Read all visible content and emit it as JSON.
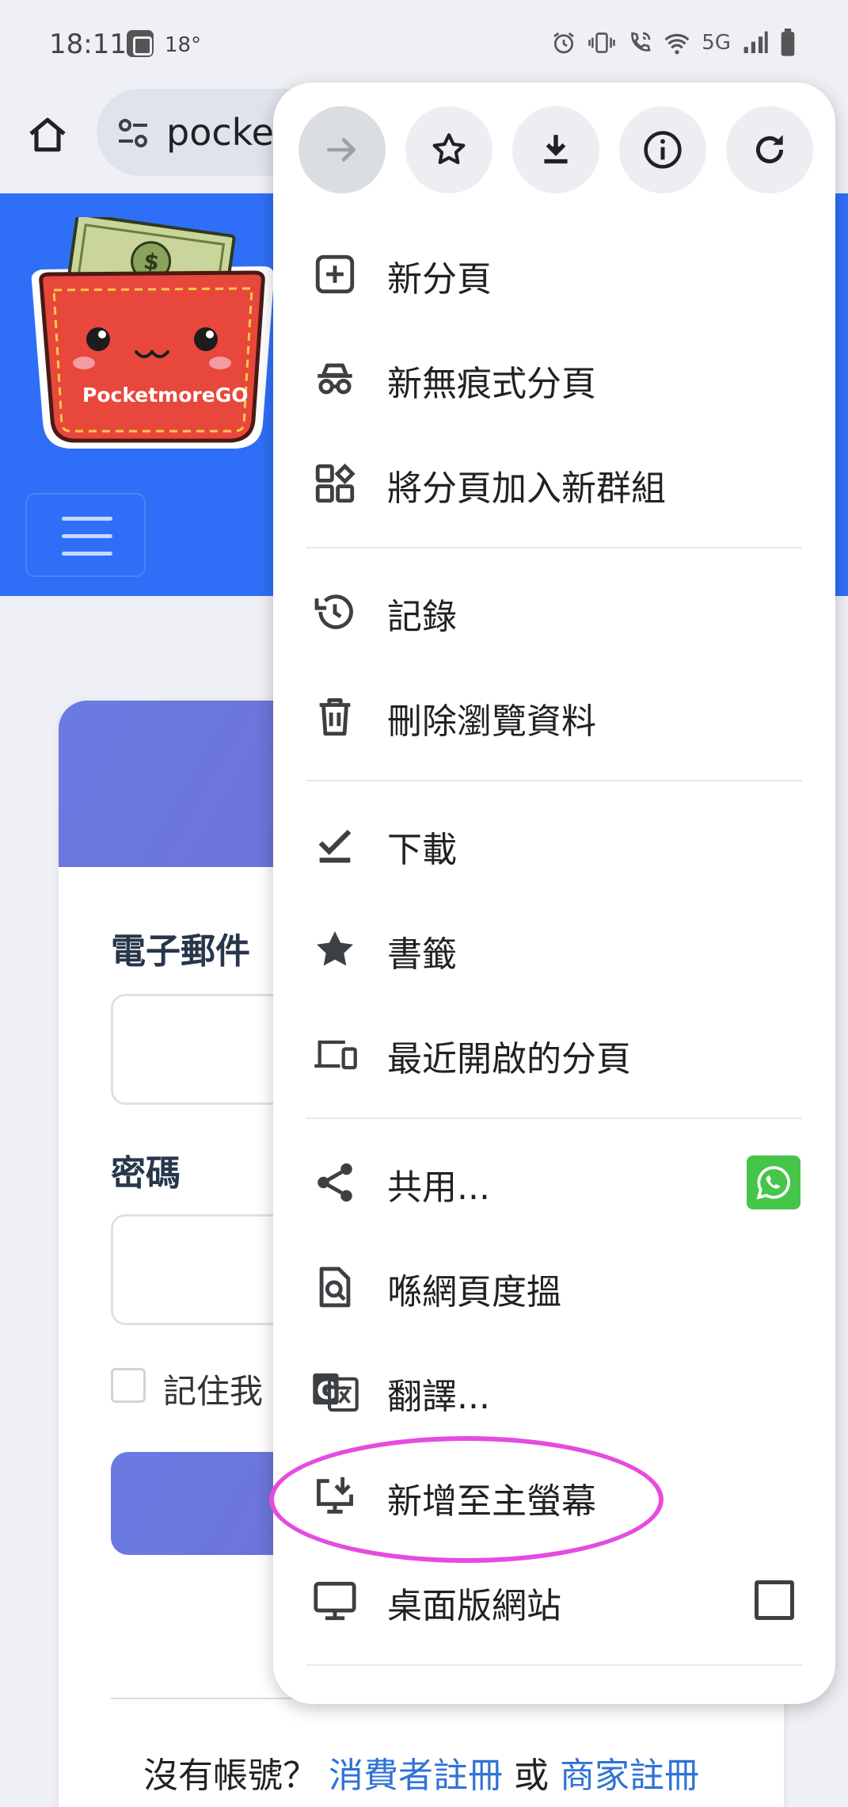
{
  "status_bar": {
    "time": "18:11",
    "temperature": "18°",
    "network": "5G",
    "icons": [
      "weather-icon",
      "alarm-icon",
      "vibrate-icon",
      "wifi-call-icon",
      "wifi-icon",
      "signal-icon",
      "battery-icon"
    ]
  },
  "toolbar": {
    "url_text": "pocket"
  },
  "page": {
    "logo_text": "PocketmoreGO",
    "email_label": "電子郵件",
    "password_label": "密碼",
    "remember_label": "記住我",
    "register_prefix": "沒有帳號？",
    "consumer_register": "消費者註冊",
    "or_text": "或",
    "merchant_register": "商家註冊"
  },
  "menu": {
    "top_actions": [
      "forward-icon",
      "bookmark-star-icon",
      "download-icon",
      "info-icon",
      "refresh-icon"
    ],
    "items": [
      {
        "label": "新分頁",
        "icon": "new-tab-icon"
      },
      {
        "label": "新無痕式分頁",
        "icon": "incognito-icon"
      },
      {
        "label": "將分頁加入新群組",
        "icon": "tab-group-icon"
      },
      {
        "label": "記錄",
        "icon": "history-icon"
      },
      {
        "label": "刪除瀏覽資料",
        "icon": "trash-icon"
      },
      {
        "label": "下載",
        "icon": "downloads-icon"
      },
      {
        "label": "書籤",
        "icon": "bookmarks-icon"
      },
      {
        "label": "最近開啟的分頁",
        "icon": "recent-tabs-icon"
      },
      {
        "label": "共用...",
        "icon": "share-icon"
      },
      {
        "label": "喺網頁度搵",
        "icon": "find-in-page-icon"
      },
      {
        "label": "翻譯...",
        "icon": "translate-icon"
      },
      {
        "label": "新增至主螢幕",
        "icon": "add-to-home-icon"
      },
      {
        "label": "桌面版網站",
        "icon": "desktop-site-icon"
      }
    ],
    "highlight_color": "#e64bdf",
    "share_shortcut_color": "#45c64a"
  }
}
